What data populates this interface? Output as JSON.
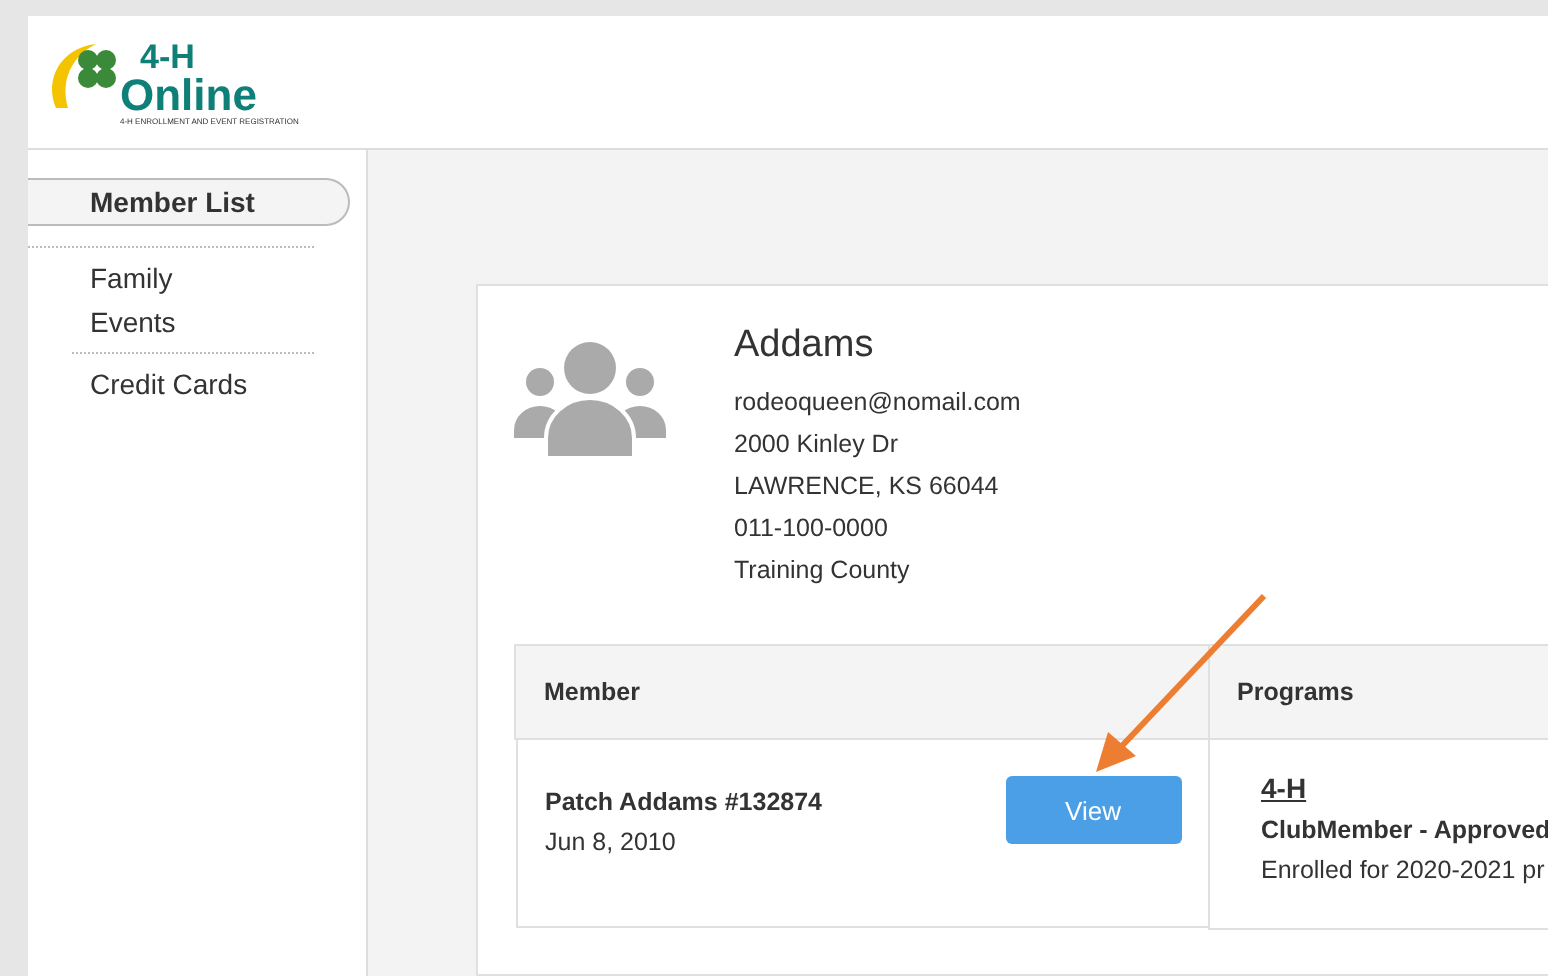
{
  "logo": {
    "title": "4-H",
    "subtitle": "Online",
    "tagline": "4-H ENROLLMENT AND EVENT REGISTRATION"
  },
  "sidebar": {
    "sections": [
      [
        {
          "label": "Member List",
          "selected": true
        }
      ],
      [
        {
          "label": "Family",
          "selected": false
        },
        {
          "label": "Events",
          "selected": false
        }
      ],
      [
        {
          "label": "Credit Cards",
          "selected": false
        }
      ]
    ]
  },
  "family": {
    "name": "Addams",
    "details": [
      "rodeoqueen@nomail.com",
      "2000 Kinley Dr",
      "LAWRENCE, KS 66044",
      "011-100-0000",
      "Training County"
    ]
  },
  "table": {
    "columns": [
      "Member",
      "Programs"
    ],
    "rows": [
      {
        "member_name": "Patch Addams #132874",
        "birth_date": "Jun 8, 2010",
        "action": "View",
        "program": "4-H",
        "status": "ClubMember - Approved",
        "enrollment": "Enrolled for 2020-2021 pr"
      }
    ]
  }
}
